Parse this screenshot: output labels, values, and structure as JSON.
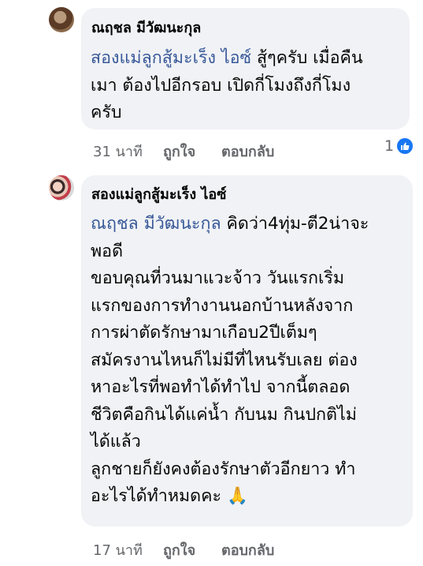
{
  "comments": [
    {
      "author": "ณฤชล มีวัฒนะกุล",
      "mention": "สองแม่ลูกสู้มะเร็ง ไอซ์",
      "lines": [
        "สู้ๆครับ เมื่อคืน",
        "เมา ต้องไปอีกรอบ เปิดกี่โมงถึงกี่โมง",
        "ครับ"
      ],
      "time": "31 นาที",
      "like_label": "ถูกใจ",
      "reply_label": "ตอบกลับ",
      "reaction_count": "1",
      "reaction_icon": "thumbs-up-icon"
    },
    {
      "author": "สองแม่ลูกสู้มะเร็ง ไอซ์",
      "mention": "ณฤชล มีวัฒนะกุล",
      "lines": [
        "คิดว่า4ทุ่ม-ตี2น่าจะ",
        "พอดี",
        "ขอบคุณที่วนมาแวะจ้าว วันแรกเริ่ม",
        "แรกของการทำงานนอกบ้านหลังจาก",
        "การผ่าตัดรักษามาเกือบ2ปีเต็มๆ",
        "สมัครงานไหนก็ไม่มีที่ไหนรับเลย ต่อง",
        "หาอะไรที่พอทำได้ทำไป จากนี้ตลอด",
        "ชีวิตคือกินได้แค่น้ำ กับนม กินปกติไม่",
        "ได้แล้ว",
        "ลูกชายก็ยังคงต้องรักษาตัวอีกยาว ทำ",
        "อะไรได้ทำหมดคะ"
      ],
      "emoji": "🙏",
      "time": "17 นาที",
      "like_label": "ถูกใจ",
      "reply_label": "ตอบกลับ"
    }
  ],
  "colors": {
    "bubble": "#f0f2f5",
    "mention": "#385898",
    "meta": "#65676b",
    "like": "#1877f2"
  }
}
